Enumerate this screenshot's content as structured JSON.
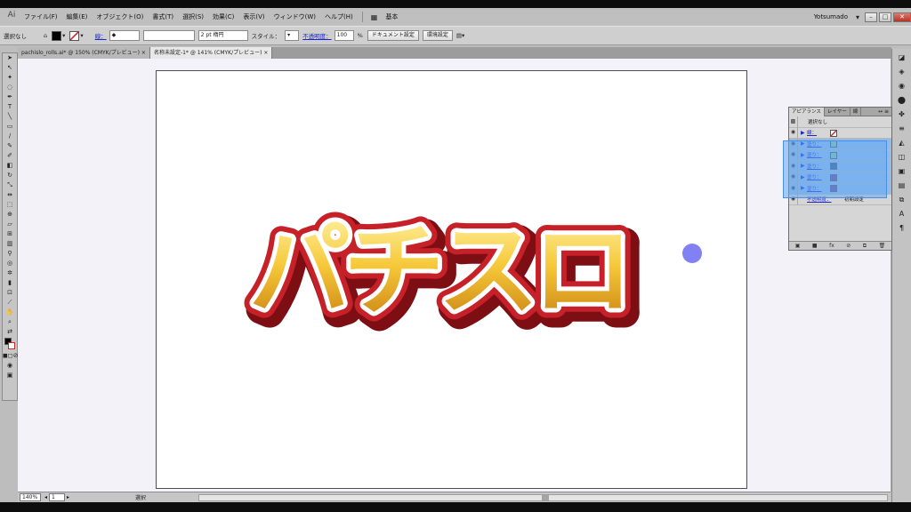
{
  "menu": {
    "items": [
      "ファイル(F)",
      "編集(E)",
      "オブジェクト(O)",
      "書式(T)",
      "選択(S)",
      "効果(C)",
      "表示(V)",
      "ウィンドウ(W)",
      "ヘルプ(H)"
    ],
    "workspace": "基本",
    "user": "Yotsumado"
  },
  "control_bar": {
    "selection_label": "選択なし",
    "stroke_label": "線：",
    "stroke_width": "2 pt 楕円",
    "style_label": "スタイル：",
    "opacity_label": "不透明度：",
    "opacity_value": "100",
    "opacity_unit": "%",
    "doc_setup_button": "ドキュメント設定",
    "prefs_button": "環境設定",
    "colors": {
      "fill": "#000000",
      "stroke": "#c8282a"
    }
  },
  "tabs": [
    {
      "label": "pachislo_rolls.ai* @ 150% (CMYK/プレビュー)",
      "close": "×"
    },
    {
      "label": "名称未設定-1* @ 141% (CMYK/プレビュー)",
      "close": "×"
    }
  ],
  "artwork": {
    "text": "パチスロ"
  },
  "status": {
    "zoom": "140%",
    "page": "1",
    "mode": "選択"
  },
  "appearance_panel": {
    "tabs": [
      "アピアランス",
      "レイヤー",
      "線"
    ],
    "header": "選択なし",
    "stroke_row": "線：",
    "fill_rows": [
      "塗り：",
      "塗り：",
      "塗り：",
      "塗り：",
      "塗り："
    ],
    "fill_colors": [
      "#7fcaa6",
      "#7fcaa6",
      "#2a5a95",
      "#6a45a3",
      "#6a45a3"
    ],
    "opacity_label": "不透明度：",
    "opacity_value": "初期設定"
  }
}
